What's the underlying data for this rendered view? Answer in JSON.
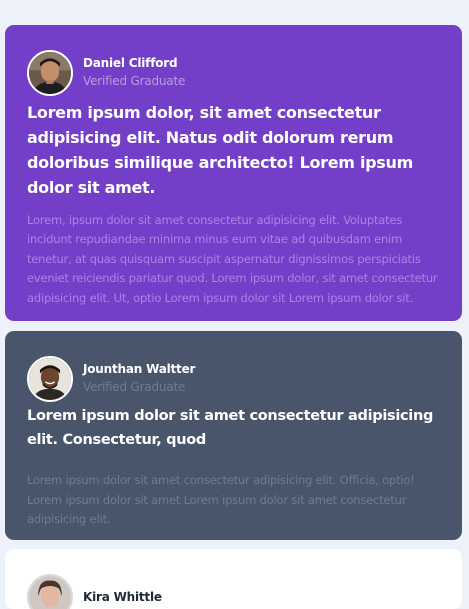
{
  "colors": {
    "page_background": "#edf2fa",
    "card1_background": "#733fc8",
    "card2_background": "#48556a",
    "card3_background": "#ffffff"
  },
  "testimonials": [
    {
      "name": "Daniel Clifford",
      "role": "Verified Graduate",
      "headline": "Lorem ipsum dolor, sit amet consectetur adipisicing elit. Natus odit dolorum rerum doloribus similique architecto! Lorem ipsum dolor sit amet.",
      "body": "Lorem, ipsum dolor sit amet consectetur adipisicing elit. Voluptates incidunt repudiandae minima minus eum vitae ad quibusdam enim tenetur, at quas quisquam suscipit aspernatur dignissimos perspiciatis eveniet reiciendis pariatur quod. Lorem ipsum dolor, sit amet consectetur adipisicing elit. Ut, optio Lorem ipsum dolor sit Lorem ipsum dolor sit."
    },
    {
      "name": "Jounthan Waltter",
      "role": "Verified Graduate",
      "headline": "Lorem ipsum dolor sit amet consectetur adipisicing elit. Consectetur, quod",
      "body": "Lorem ipsum dolor sit amet consectetur adipisicing elit. Officia, optio! Lorem ipsum dolor sit amet Lorem ipsum dolor sit amet consectetur adipisicing elit."
    },
    {
      "name": "Kira Whittle"
    }
  ]
}
